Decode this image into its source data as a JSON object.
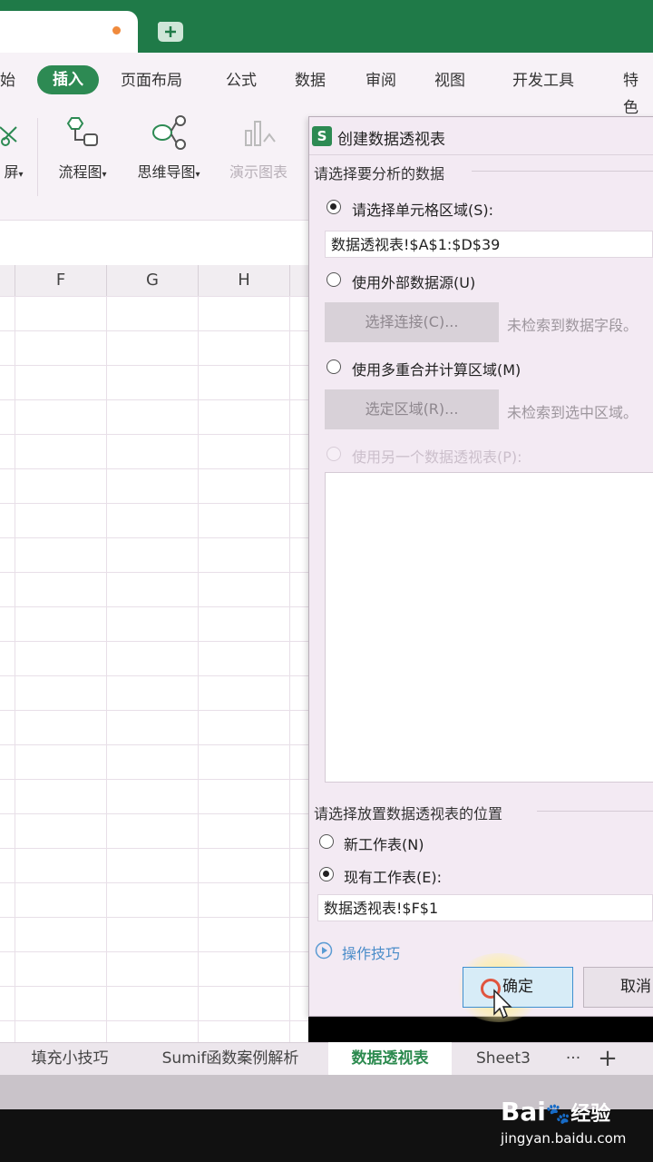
{
  "ribbon": {
    "tabs": [
      "始",
      "插入",
      "页面布局",
      "公式",
      "数据",
      "审阅",
      "视图",
      "开发工具",
      "特色"
    ],
    "tools": {
      "partial": "屏",
      "flowchart": "流程图",
      "mindmap": "思维导图",
      "demo_chart": "演示图表"
    }
  },
  "grid": {
    "columns": [
      "F",
      "G",
      "H"
    ]
  },
  "dialog": {
    "title": "创建数据透视表",
    "section1_label": "请选择要分析的数据",
    "option_range": "请选择单元格区域(S):",
    "range_value": "数据透视表!$A$1:$D$39",
    "option_external": "使用外部数据源(U)",
    "choose_connection_btn": "选择连接(C)...",
    "no_fields_hint": "未检索到数据字段。",
    "option_multi": "使用多重合并计算区域(M)",
    "select_range_btn": "选定区域(R)...",
    "no_range_hint": "未检索到选中区域。",
    "option_other_pivot": "使用另一个数据透视表(P):",
    "section2_label": "请选择放置数据透视表的位置",
    "option_new_sheet": "新工作表(N)",
    "option_existing_sheet": "现有工作表(E):",
    "location_value": "数据透视表!$F$1",
    "tips_link": "操作技巧",
    "ok_label": "确定",
    "cancel_label": "取消"
  },
  "sheets": {
    "tabs": [
      "填充小技巧",
      "Sumif函数案例解析",
      "数据透视表",
      "Sheet3"
    ],
    "more": "···",
    "add": "+"
  },
  "watermark": {
    "brand": "Bai",
    "suffix": "经验",
    "url": "jingyan.baidu.com"
  },
  "colors": {
    "accent_green": "#2d8a53",
    "titlebar": "#1f7a48",
    "ok_border": "#3f8fd0"
  }
}
